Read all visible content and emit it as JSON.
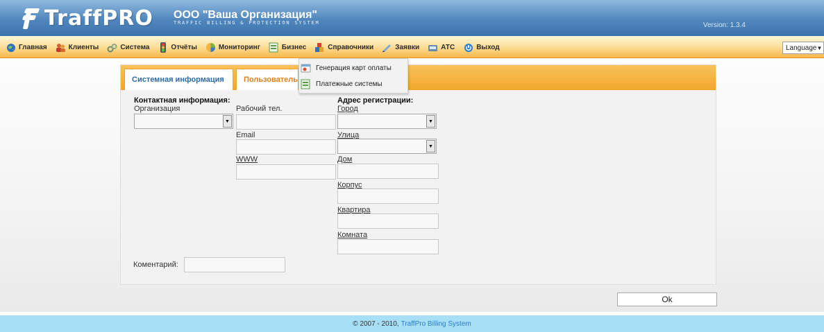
{
  "header": {
    "logo_text": "TraffPRO",
    "org_name": "ООО \"Ваша Организация\"",
    "org_subtitle": "TRAFFIC BILLING & PROTECTION SYSTEM",
    "version": "Version: 1.3.4"
  },
  "menu": {
    "items": [
      {
        "label": "Главная",
        "icon": "globe-icon"
      },
      {
        "label": "Клиенты",
        "icon": "users-icon"
      },
      {
        "label": "Система",
        "icon": "gears-icon"
      },
      {
        "label": "Отчёты",
        "icon": "traffic-light-icon"
      },
      {
        "label": "Мониторинг",
        "icon": "monitoring-icon"
      },
      {
        "label": "Бизнес",
        "icon": "spreadsheet-icon"
      },
      {
        "label": "Справочники",
        "icon": "blocks-icon"
      },
      {
        "label": "Заявки",
        "icon": "pen-icon"
      },
      {
        "label": "АТС",
        "icon": "phone-icon"
      },
      {
        "label": "Выход",
        "icon": "power-icon"
      }
    ],
    "language": "Language"
  },
  "submenu": {
    "items": [
      {
        "label": "Генерация карт оплаты",
        "icon": "card-icon"
      },
      {
        "label": "Платежные системы",
        "icon": "spreadsheet-icon"
      }
    ]
  },
  "tabs": {
    "system_info": "Системная информация",
    "user_tab": "Пользовательская"
  },
  "form": {
    "contact_title": "Контактная информация:",
    "org_label": "Организация",
    "work_phone_label": "Рабочий тел.",
    "email_label": "Email",
    "www_label": "WWW",
    "address_title": "Адрес регистрации:",
    "city_label": "Город",
    "street_label": "Улица",
    "house_label": "Дом",
    "building_label": "Корпус",
    "apartment_label": "Квартира",
    "room_label": "Комната",
    "comment_label": "Коментарий:"
  },
  "actions": {
    "ok": "Ok"
  },
  "footer": {
    "copyright": "© 2007 - 2010,",
    "link": "TraffPro Billing System"
  },
  "colors": {
    "header_blue": "#4f86bd",
    "menu_orange": "#f7b84a",
    "tab_active": "#e0801e",
    "tab_link": "#2b6aa3",
    "footer_bg": "#a6dff6",
    "footer_link": "#2b7cc9"
  }
}
